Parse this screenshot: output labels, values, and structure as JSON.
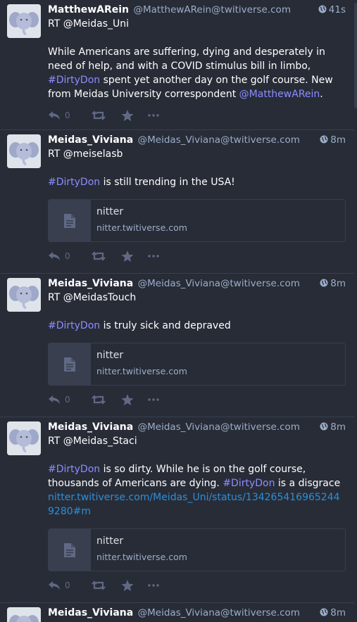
{
  "statuses": [
    {
      "display_name": "MatthewARein",
      "acct": "@MatthewARein@twitiverse.com",
      "time": "41s",
      "rt_line": "RT @Meidas_Uni",
      "body_parts": [
        "While Americans are suffering, dying and desperately in need of help, and with a COVID stimulus bill in limbo, ",
        "#DirtyDon",
        " spent yet another day on the golf course. New from Meidas University correspondent ",
        "@MatthewARein",
        "."
      ],
      "reply_count": "0"
    },
    {
      "display_name": "Meidas_Viviana",
      "acct": "@Meidas_Viviana@twitiverse.com",
      "time": "8m",
      "rt_line": "RT @meiselasb",
      "hashtag": "#DirtyDon",
      "body_rest": " is still trending in the USA!",
      "card": {
        "title": "nitter",
        "host": "nitter.twitiverse.com"
      },
      "reply_count": "0"
    },
    {
      "display_name": "Meidas_Viviana",
      "acct": "@Meidas_Viviana@twitiverse.com",
      "time": "8m",
      "rt_line": "RT @MeidasTouch",
      "hashtag": "#DirtyDon",
      "body_rest": " is truly sick and depraved",
      "card": {
        "title": "nitter",
        "host": "nitter.twitiverse.com"
      },
      "reply_count": "0"
    },
    {
      "display_name": "Meidas_Viviana",
      "acct": "@Meidas_Viviana@twitiverse.com",
      "time": "8m",
      "rt_line": "RT @Meidas_Staci",
      "body_parts": [
        "#DirtyDon",
        " is so dirty. While he is on the golf course, thousands of Americans are dying. ",
        "#DirtyDon",
        " is a disgrace"
      ],
      "link": "nitter.twitiverse.com/Meidas_Uni/status/1342654169652449280#m",
      "card": {
        "title": "nitter",
        "host": "nitter.twitiverse.com"
      },
      "reply_count": "0"
    },
    {
      "display_name": "Meidas_Viviana",
      "acct": "@Meidas_Viviana@twitiverse.com",
      "time": "8m"
    }
  ],
  "colors": {
    "background": "#282c37",
    "border": "#393f4f",
    "text": "#ffffff",
    "secondary": "#9baec8",
    "hashtag": "#8c8dff",
    "link": "#2b90d9",
    "action_icon": "#606984"
  },
  "icons": [
    "elephant-avatar-icon",
    "globe-icon",
    "reply-icon",
    "boost-icon",
    "star-icon",
    "ellipsis-icon",
    "document-icon"
  ]
}
